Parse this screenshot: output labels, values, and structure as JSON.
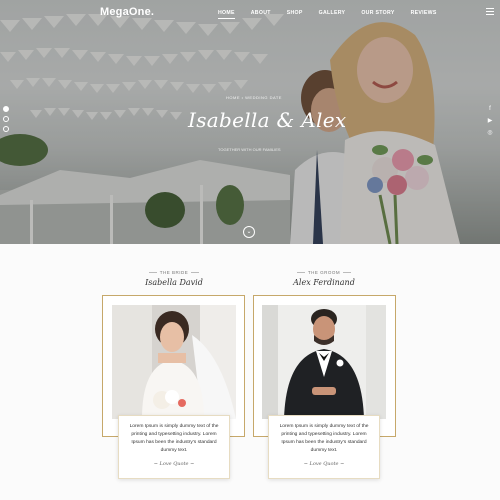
{
  "header": {
    "logo": "MegaOne.",
    "nav": [
      {
        "label": "HOME",
        "active": true
      },
      {
        "label": "ABOUT"
      },
      {
        "label": "SHOP"
      },
      {
        "label": "GALLERY"
      },
      {
        "label": "OUR STORY"
      },
      {
        "label": "REVIEWS"
      }
    ]
  },
  "hero": {
    "breadcrumb": "HOME  •  WEDDING DATE",
    "title": "Isabella & Alex",
    "subtitle": "TOGETHER WITH OUR FAMILIES",
    "socials": [
      "f",
      "▶",
      "◎"
    ]
  },
  "bride": {
    "eyebrow": "THE BRIDE",
    "name": "Isabella David",
    "quote": "Lorem Ipsum is simply dummy text of the printing and typesetting industry. Lorem Ipsum has been the industry's standard dummy text.",
    "signature": "~ Love Quote ~"
  },
  "groom": {
    "eyebrow": "THE GROOM",
    "name": "Alex Ferdinand",
    "quote": "Lorem Ipsum is simply dummy text of the printing and typesetting industry. Lorem Ipsum has been the industry's standard dummy text.",
    "signature": "~ Love Quote ~"
  },
  "colors": {
    "gold": "#c6a86a",
    "text": "#333333"
  }
}
